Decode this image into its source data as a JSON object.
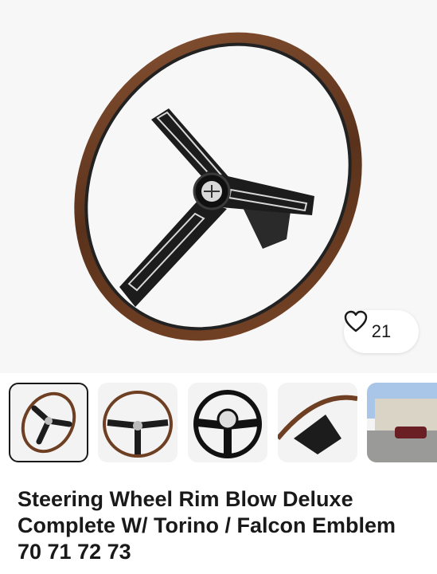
{
  "listing": {
    "title": "Steering Wheel Rim Blow Deluxe Complete W/ Torino / Falcon Emblem 70 71 72 73",
    "watchers": "21",
    "watch_icon": "heart-icon"
  },
  "gallery": {
    "thumbnails": [
      {
        "name": "thumbnail-1",
        "selected": true
      },
      {
        "name": "thumbnail-2",
        "selected": false
      },
      {
        "name": "thumbnail-3",
        "selected": false
      },
      {
        "name": "thumbnail-4",
        "selected": false
      },
      {
        "name": "thumbnail-5",
        "selected": false
      }
    ]
  },
  "colors": {
    "wood": "#6e3f22",
    "spoke": "#1c1c1c",
    "background": "#f7f7f7",
    "text": "#191919"
  }
}
